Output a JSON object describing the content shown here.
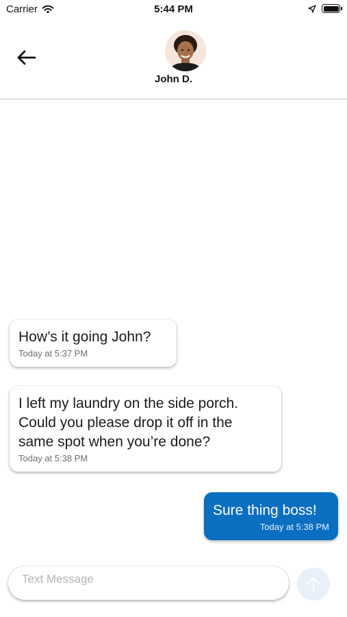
{
  "status_bar": {
    "carrier": "Carrier",
    "time": "5:44 PM"
  },
  "header": {
    "contact_name": "John D."
  },
  "messages": [
    {
      "direction": "incoming",
      "text": "How’s it going John?",
      "time": "Today at 5:37 PM"
    },
    {
      "direction": "incoming",
      "text": "I left my laundry on the side porch.\nCould you please drop it off in the\nsame spot when you’re done?",
      "time": "Today at 5:38 PM"
    },
    {
      "direction": "outgoing",
      "text": "Sure thing boss!",
      "time": "Today at 5:38 PM"
    }
  ],
  "composer": {
    "placeholder": "Text Message",
    "value": ""
  },
  "colors": {
    "outgoing_bubble": "#0a6ec1",
    "send_button_disabled": "#e8f1fa"
  },
  "icons": {
    "back": "arrow-left-icon",
    "send": "arrow-up-icon",
    "wifi": "wifi-icon",
    "location": "location-arrow-icon",
    "battery": "battery-icon"
  }
}
